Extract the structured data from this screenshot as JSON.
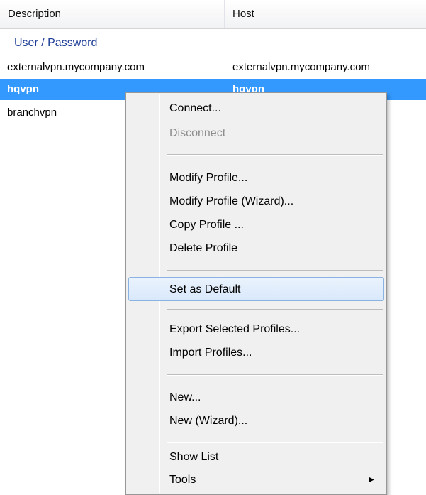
{
  "columns": {
    "description": "Description",
    "host": "Host"
  },
  "group": {
    "title": "User / Password"
  },
  "rows": [
    {
      "description": "externalvpn.mycompany.com",
      "host": "externalvpn.mycompany.com"
    },
    {
      "description": "hqvpn",
      "host": "hqvpn",
      "selected": true
    },
    {
      "description": "branchvpn",
      "host": ""
    }
  ],
  "menu": {
    "connect": "Connect...",
    "disconnect": "Disconnect",
    "modify_profile": "Modify Profile...",
    "modify_profile_wizard": "Modify Profile (Wizard)...",
    "copy_profile": "Copy Profile ...",
    "delete_profile": "Delete Profile",
    "set_as_default": "Set as Default",
    "export_profiles": "Export Selected Profiles...",
    "import_profiles": "Import Profiles...",
    "new": "New...",
    "new_wizard": "New (Wizard)...",
    "show_list": "Show List",
    "tools": "Tools",
    "tools_arrow": "▶"
  },
  "colors": {
    "selection": "#3399ff",
    "group_title": "#1e3d96",
    "menu_background": "#f0f0f0",
    "highlight_border": "#8ab2e3"
  }
}
